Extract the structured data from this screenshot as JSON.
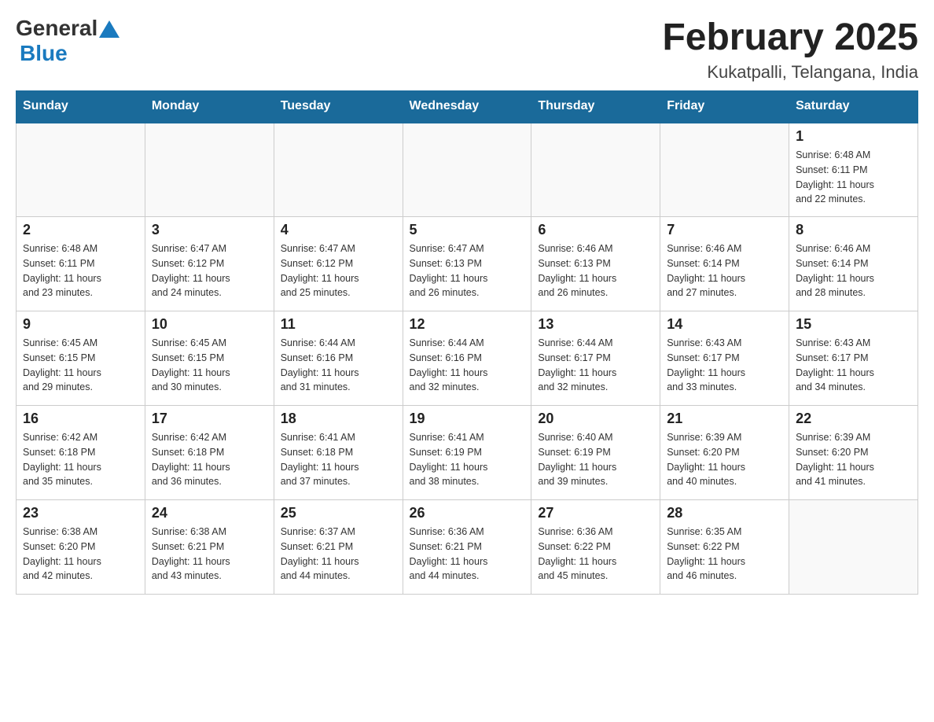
{
  "header": {
    "logo_general": "General",
    "logo_blue": "Blue",
    "title": "February 2025",
    "subtitle": "Kukatpalli, Telangana, India"
  },
  "weekdays": [
    "Sunday",
    "Monday",
    "Tuesday",
    "Wednesday",
    "Thursday",
    "Friday",
    "Saturday"
  ],
  "weeks": [
    [
      {
        "day": "",
        "info": ""
      },
      {
        "day": "",
        "info": ""
      },
      {
        "day": "",
        "info": ""
      },
      {
        "day": "",
        "info": ""
      },
      {
        "day": "",
        "info": ""
      },
      {
        "day": "",
        "info": ""
      },
      {
        "day": "1",
        "info": "Sunrise: 6:48 AM\nSunset: 6:11 PM\nDaylight: 11 hours\nand 22 minutes."
      }
    ],
    [
      {
        "day": "2",
        "info": "Sunrise: 6:48 AM\nSunset: 6:11 PM\nDaylight: 11 hours\nand 23 minutes."
      },
      {
        "day": "3",
        "info": "Sunrise: 6:47 AM\nSunset: 6:12 PM\nDaylight: 11 hours\nand 24 minutes."
      },
      {
        "day": "4",
        "info": "Sunrise: 6:47 AM\nSunset: 6:12 PM\nDaylight: 11 hours\nand 25 minutes."
      },
      {
        "day": "5",
        "info": "Sunrise: 6:47 AM\nSunset: 6:13 PM\nDaylight: 11 hours\nand 26 minutes."
      },
      {
        "day": "6",
        "info": "Sunrise: 6:46 AM\nSunset: 6:13 PM\nDaylight: 11 hours\nand 26 minutes."
      },
      {
        "day": "7",
        "info": "Sunrise: 6:46 AM\nSunset: 6:14 PM\nDaylight: 11 hours\nand 27 minutes."
      },
      {
        "day": "8",
        "info": "Sunrise: 6:46 AM\nSunset: 6:14 PM\nDaylight: 11 hours\nand 28 minutes."
      }
    ],
    [
      {
        "day": "9",
        "info": "Sunrise: 6:45 AM\nSunset: 6:15 PM\nDaylight: 11 hours\nand 29 minutes."
      },
      {
        "day": "10",
        "info": "Sunrise: 6:45 AM\nSunset: 6:15 PM\nDaylight: 11 hours\nand 30 minutes."
      },
      {
        "day": "11",
        "info": "Sunrise: 6:44 AM\nSunset: 6:16 PM\nDaylight: 11 hours\nand 31 minutes."
      },
      {
        "day": "12",
        "info": "Sunrise: 6:44 AM\nSunset: 6:16 PM\nDaylight: 11 hours\nand 32 minutes."
      },
      {
        "day": "13",
        "info": "Sunrise: 6:44 AM\nSunset: 6:17 PM\nDaylight: 11 hours\nand 32 minutes."
      },
      {
        "day": "14",
        "info": "Sunrise: 6:43 AM\nSunset: 6:17 PM\nDaylight: 11 hours\nand 33 minutes."
      },
      {
        "day": "15",
        "info": "Sunrise: 6:43 AM\nSunset: 6:17 PM\nDaylight: 11 hours\nand 34 minutes."
      }
    ],
    [
      {
        "day": "16",
        "info": "Sunrise: 6:42 AM\nSunset: 6:18 PM\nDaylight: 11 hours\nand 35 minutes."
      },
      {
        "day": "17",
        "info": "Sunrise: 6:42 AM\nSunset: 6:18 PM\nDaylight: 11 hours\nand 36 minutes."
      },
      {
        "day": "18",
        "info": "Sunrise: 6:41 AM\nSunset: 6:18 PM\nDaylight: 11 hours\nand 37 minutes."
      },
      {
        "day": "19",
        "info": "Sunrise: 6:41 AM\nSunset: 6:19 PM\nDaylight: 11 hours\nand 38 minutes."
      },
      {
        "day": "20",
        "info": "Sunrise: 6:40 AM\nSunset: 6:19 PM\nDaylight: 11 hours\nand 39 minutes."
      },
      {
        "day": "21",
        "info": "Sunrise: 6:39 AM\nSunset: 6:20 PM\nDaylight: 11 hours\nand 40 minutes."
      },
      {
        "day": "22",
        "info": "Sunrise: 6:39 AM\nSunset: 6:20 PM\nDaylight: 11 hours\nand 41 minutes."
      }
    ],
    [
      {
        "day": "23",
        "info": "Sunrise: 6:38 AM\nSunset: 6:20 PM\nDaylight: 11 hours\nand 42 minutes."
      },
      {
        "day": "24",
        "info": "Sunrise: 6:38 AM\nSunset: 6:21 PM\nDaylight: 11 hours\nand 43 minutes."
      },
      {
        "day": "25",
        "info": "Sunrise: 6:37 AM\nSunset: 6:21 PM\nDaylight: 11 hours\nand 44 minutes."
      },
      {
        "day": "26",
        "info": "Sunrise: 6:36 AM\nSunset: 6:21 PM\nDaylight: 11 hours\nand 44 minutes."
      },
      {
        "day": "27",
        "info": "Sunrise: 6:36 AM\nSunset: 6:22 PM\nDaylight: 11 hours\nand 45 minutes."
      },
      {
        "day": "28",
        "info": "Sunrise: 6:35 AM\nSunset: 6:22 PM\nDaylight: 11 hours\nand 46 minutes."
      },
      {
        "day": "",
        "info": ""
      }
    ]
  ]
}
